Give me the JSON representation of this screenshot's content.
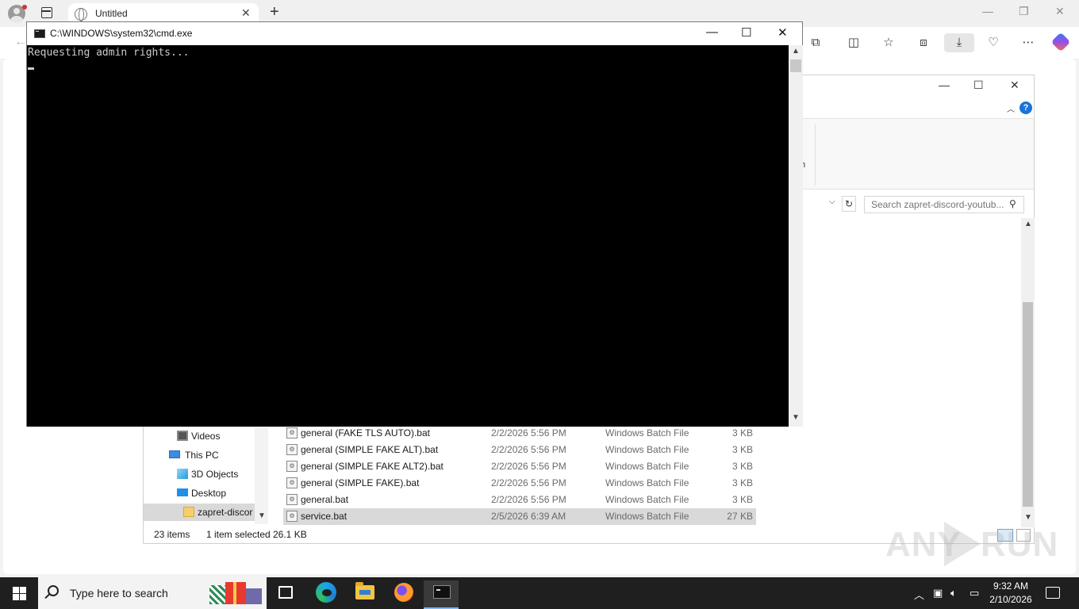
{
  "edge": {
    "tab_title": "Untitled",
    "tab_close": "✕",
    "new_tab": "+",
    "window_controls": {
      "minimize": "—",
      "restore": "❐",
      "close": "✕"
    },
    "back": "←",
    "toolbar_icons": [
      "extensions-icon",
      "split-screen-icon",
      "favorites-icon",
      "collections-icon",
      "downloads-icon",
      "browser-essentials-icon",
      "more-icon"
    ]
  },
  "cmd": {
    "title": "C:\\WINDOWS\\system32\\cmd.exe",
    "output": "Requesting admin rights...",
    "controls": {
      "minimize": "—",
      "maximize": "☐",
      "close": "✕"
    },
    "scroll_up": "▲",
    "scroll_down": "▼"
  },
  "explorer": {
    "controls": {
      "minimize": "—",
      "maximize": "☐",
      "close": "✕"
    },
    "ribbon_letter": "h",
    "search_placeholder": "Search zapret-discord-youtub...",
    "help": "?",
    "nav": [
      {
        "label": "Videos",
        "icon": "videos-icon"
      },
      {
        "label": "This PC",
        "icon": "this-pc-icon"
      },
      {
        "label": "3D Objects",
        "icon": "3d-objects-icon"
      },
      {
        "label": "Desktop",
        "icon": "desktop-icon"
      },
      {
        "label": "zapret-discor",
        "icon": "folder-icon",
        "selected": true
      }
    ],
    "files": [
      {
        "name": "general (FAKE TLS AUTO).bat",
        "date": "2/2/2026 5:56 PM",
        "type": "Windows Batch File",
        "size": "3 KB"
      },
      {
        "name": "general (SIMPLE FAKE ALT).bat",
        "date": "2/2/2026 5:56 PM",
        "type": "Windows Batch File",
        "size": "3 KB"
      },
      {
        "name": "general (SIMPLE FAKE ALT2).bat",
        "date": "2/2/2026 5:56 PM",
        "type": "Windows Batch File",
        "size": "3 KB"
      },
      {
        "name": "general (SIMPLE FAKE).bat",
        "date": "2/2/2026 5:56 PM",
        "type": "Windows Batch File",
        "size": "3 KB"
      },
      {
        "name": "general.bat",
        "date": "2/2/2026 5:56 PM",
        "type": "Windows Batch File",
        "size": "3 KB"
      },
      {
        "name": "service.bat",
        "date": "2/5/2026 6:39 AM",
        "type": "Windows Batch File",
        "size": "27 KB",
        "selected": true
      }
    ],
    "status": {
      "items": "23 items",
      "selected": "1 item selected",
      "size": "26.1 KB"
    }
  },
  "taskbar": {
    "search_placeholder": "Type here to search",
    "time": "9:32 AM",
    "date": "2/10/2026"
  },
  "watermark": {
    "left": "ANY",
    "right": "RUN"
  }
}
